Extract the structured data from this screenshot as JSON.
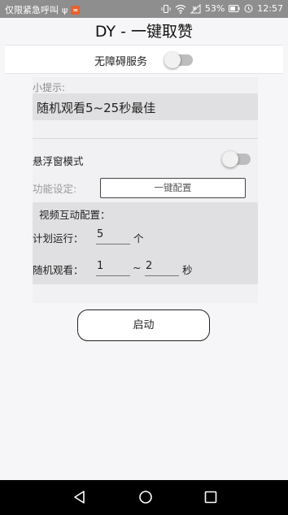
{
  "status_bar": {
    "carrier": "仅限紧急呼叫",
    "battery": "53%",
    "time": "12:57"
  },
  "app": {
    "title": "DY - 一键取赞"
  },
  "accessibility": {
    "label": "无障碍服务",
    "enabled": false
  },
  "tip": {
    "label": "小提示:",
    "text": "随机观看5~25秒最佳"
  },
  "float_mode": {
    "label": "悬浮窗模式",
    "enabled": false
  },
  "function": {
    "label": "功能设定:",
    "button_label": "一键配置"
  },
  "video_config": {
    "title": "视频互动配置：",
    "plan_label": "计划运行：",
    "plan_value": "5",
    "plan_unit": "个",
    "random_label": "随机观看：",
    "random_min": "1",
    "random_separator": "~",
    "random_max": "2",
    "random_unit": "秒"
  },
  "start_button": {
    "label": "启动"
  },
  "icons": [
    "usb-icon",
    "notification-icon",
    "vibrate-icon",
    "wifi-icon",
    "signal-icon",
    "battery-icon",
    "clock-icon",
    "back-icon",
    "home-icon",
    "recent-apps-icon"
  ]
}
